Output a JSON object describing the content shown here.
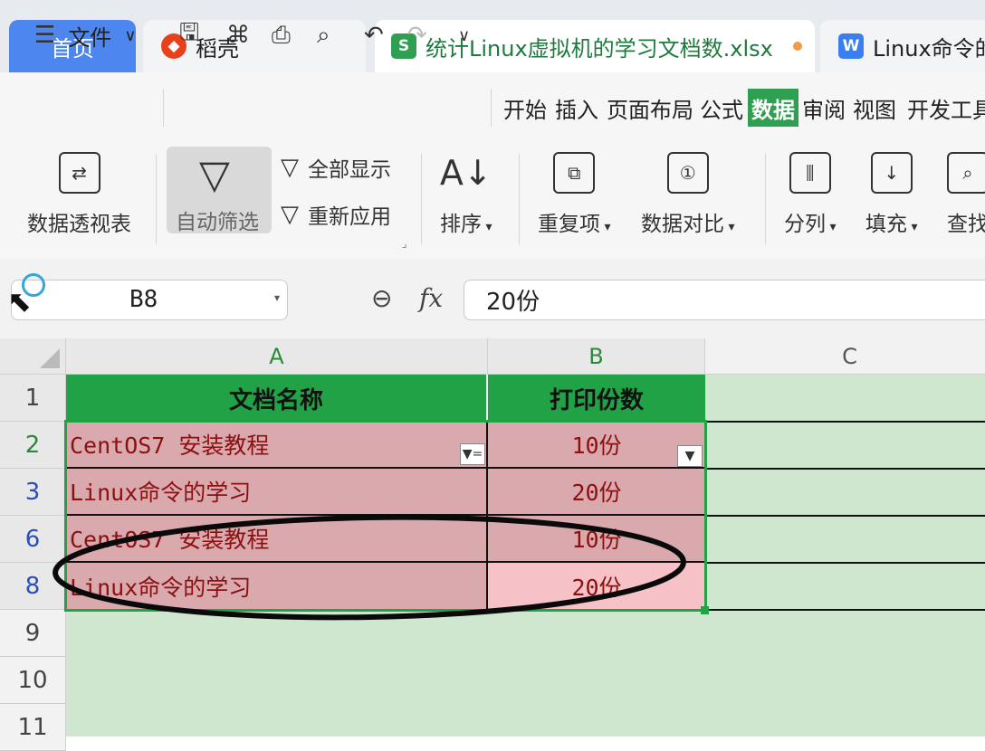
{
  "tabs": {
    "home": "首页",
    "daoke": "稻壳",
    "file": "统计Linux虚拟机的学习文档数.xlsx",
    "file_icon": "S",
    "linux": "Linux命令的",
    "linux_icon": "W"
  },
  "toolbar": {
    "file_menu": "文件",
    "menus": [
      "开始",
      "插入",
      "页面布局",
      "公式",
      "数据",
      "审阅",
      "视图",
      "开发工具"
    ]
  },
  "ribbon": {
    "pivot": "数据透视表",
    "autofilter": "自动筛选",
    "show_all": "全部显示",
    "reapply": "重新应用",
    "sort": "排序",
    "duplicates": "重复项",
    "compare": "数据对比",
    "split": "分列",
    "fill": "填充",
    "find": "查找"
  },
  "formula_bar": {
    "cell_ref": "B8",
    "fx": "fx",
    "value": "20份"
  },
  "grid": {
    "columns": [
      "A",
      "B",
      "C"
    ],
    "rows": [
      "1",
      "2",
      "3",
      "6",
      "8",
      "9",
      "10",
      "11"
    ],
    "header": [
      "文档名称",
      "打印份数"
    ],
    "data": [
      [
        "CentOS7 安装教程",
        "10份"
      ],
      [
        "Linux命令的学习",
        "20份"
      ],
      [
        "CentOS7 安装教程",
        "10份"
      ],
      [
        "Linux命令的学习",
        "20份"
      ]
    ]
  },
  "colors": {
    "accent_green": "#22a246",
    "data_red": "#8b1010",
    "home_blue": "#4d86ef"
  }
}
